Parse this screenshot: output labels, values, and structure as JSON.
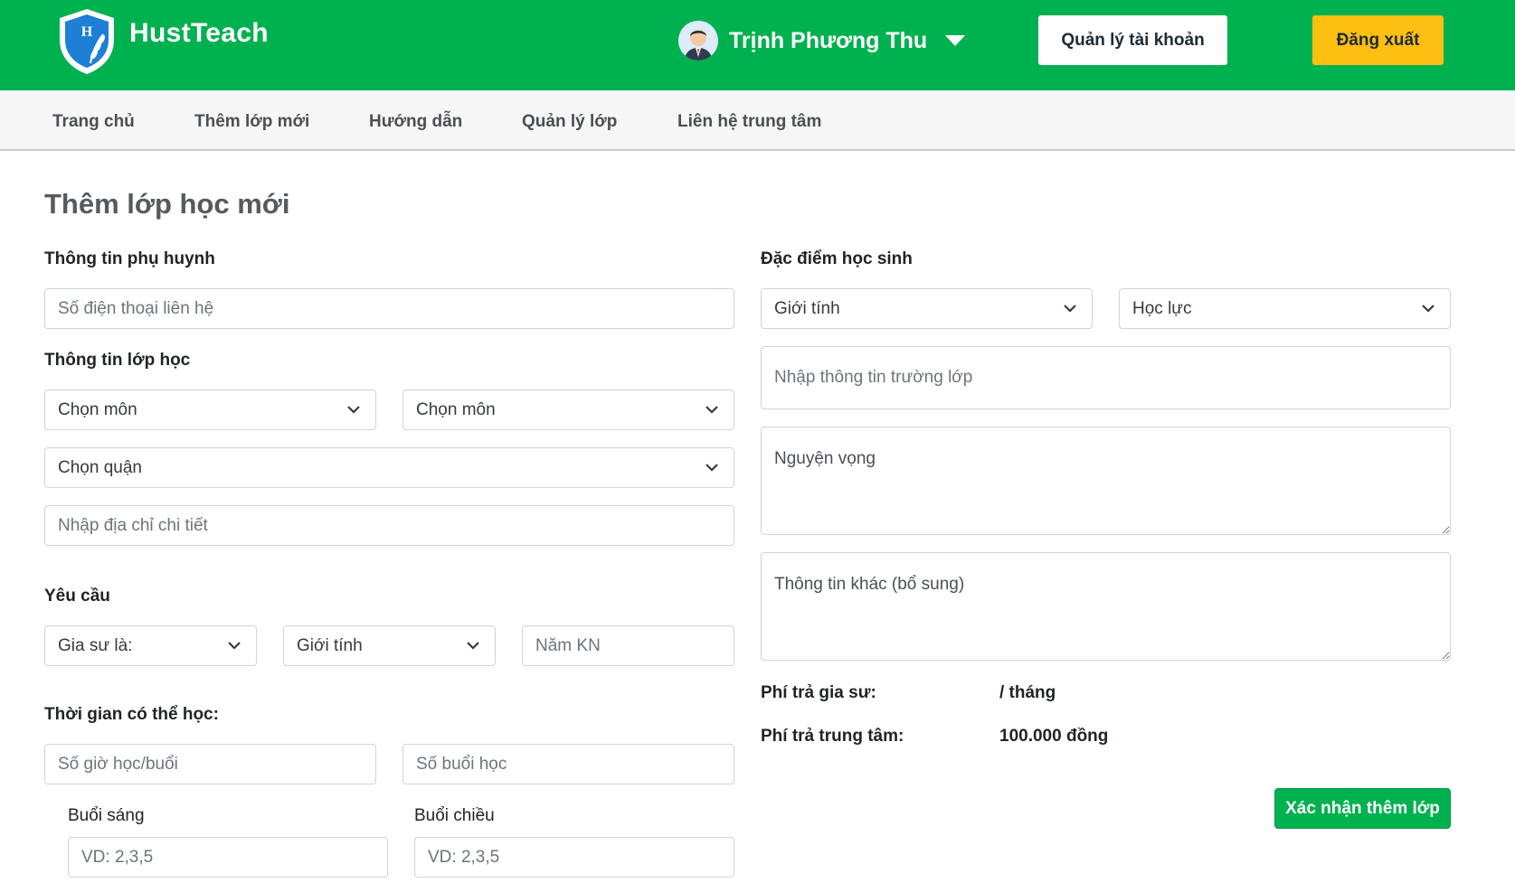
{
  "header": {
    "brand": "HustTeach",
    "user_name": "Trịnh Phương Thu",
    "account_button": "Quản lý tài khoản",
    "logout_button": "Đăng xuất",
    "brand_color": "#00b14f",
    "logout_color": "#fdbf12"
  },
  "nav": {
    "items": [
      "Trang chủ",
      "Thêm lớp mới",
      "Hướng dẫn",
      "Quản lý lớp",
      "Liên hệ trung tâm"
    ]
  },
  "form": {
    "title": "Thêm lớp học mới",
    "parent": {
      "label": "Thông tin phụ huynh",
      "phone_placeholder": "Số điện thoại liên hệ"
    },
    "class_info": {
      "label": "Thông tin lớp học",
      "subject1": "Chọn môn",
      "subject2": "Chọn môn",
      "district": "Chọn quận",
      "address_placeholder": "Nhập địa chỉ chi tiết"
    },
    "requirements": {
      "label": "Yêu cầu",
      "tutor_type": "Gia sư là:",
      "gender": "Giới tính",
      "experience_placeholder": "Năm KN"
    },
    "schedule": {
      "label": "Thời gian có thể học:",
      "hours_placeholder": "Số giờ học/buổi",
      "sessions_placeholder": "Số buổi học",
      "morning_label": "Buổi sáng",
      "afternoon_label": "Buổi chiều",
      "morning_placeholder": "VD: 2,3,5",
      "afternoon_placeholder": "VD: 2,3,5"
    },
    "student": {
      "label": "Đặc điểm học sinh",
      "gender": "Giới tính",
      "academic": "Học lực",
      "school_placeholder": "Nhập thông tin trường lớp",
      "wish_placeholder": "Nguyện vọng",
      "other_placeholder": "Thông tin khác (bổ sung)"
    },
    "fees": {
      "tutor_fee_label": "Phí trả gia sư:",
      "tutor_fee_value": "/ tháng",
      "center_fee_label": "Phí trả trung tâm:",
      "center_fee_value": "100.000 đồng"
    },
    "submit_button": "Xác nhận thêm lớp"
  }
}
